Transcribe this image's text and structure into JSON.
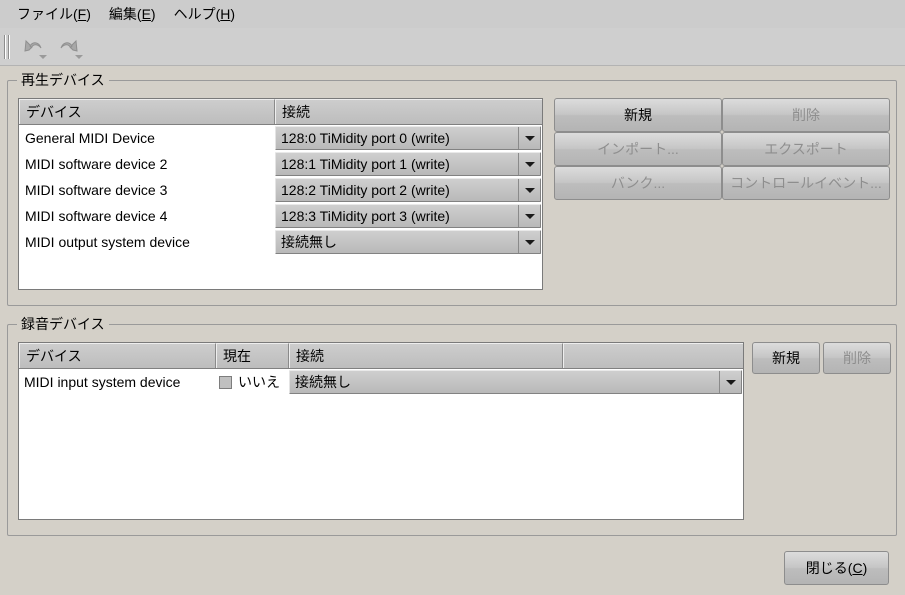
{
  "menubar": {
    "items": [
      {
        "label": "ファイル",
        "accel": "F"
      },
      {
        "label": "編集",
        "accel": "E"
      },
      {
        "label": "ヘルプ",
        "accel": "H"
      }
    ]
  },
  "toolbar": {
    "undo_tooltip": "元に戻す",
    "redo_tooltip": "やり直し"
  },
  "playback": {
    "title": "再生デバイス",
    "columns": [
      "デバイス",
      "接続"
    ],
    "rows": [
      {
        "device": "General MIDI Device",
        "connection": "128:0 TiMidity port 0 (write)"
      },
      {
        "device": "MIDI software device 2",
        "connection": "128:1 TiMidity port 1 (write)"
      },
      {
        "device": "MIDI software device 3",
        "connection": "128:2 TiMidity port 2 (write)"
      },
      {
        "device": "MIDI software device 4",
        "connection": "128:3 TiMidity port 3 (write)"
      },
      {
        "device": "MIDI output system device",
        "connection": "接続無し"
      }
    ],
    "buttons": [
      {
        "label": "新規",
        "enabled": true
      },
      {
        "label": "削除",
        "enabled": false
      },
      {
        "label": "インポート...",
        "enabled": false
      },
      {
        "label": "エクスポート",
        "enabled": false
      },
      {
        "label": "バンク...",
        "enabled": false
      },
      {
        "label": "コントロールイベント...",
        "enabled": false
      }
    ]
  },
  "record": {
    "title": "録音デバイス",
    "columns": [
      "デバイス",
      "現在",
      "接続",
      ""
    ],
    "rows": [
      {
        "device": "MIDI input system device",
        "current": "いいえ",
        "checked": false,
        "connection": "接続無し"
      }
    ],
    "buttons": [
      {
        "label": "新規",
        "enabled": true
      },
      {
        "label": "削除",
        "enabled": false
      }
    ]
  },
  "footer": {
    "close_label": "閉じる",
    "close_accel": "C"
  },
  "colors": {
    "window_bg": "#d4d0c8",
    "menubar_bg": "#cccccc",
    "toolbar_bg": "#cfcfcf",
    "list_bg": "#ffffff",
    "header_bg": "#c3c3c3",
    "disabled_text": "#8e8e8e",
    "border": "#9a9a9a"
  }
}
